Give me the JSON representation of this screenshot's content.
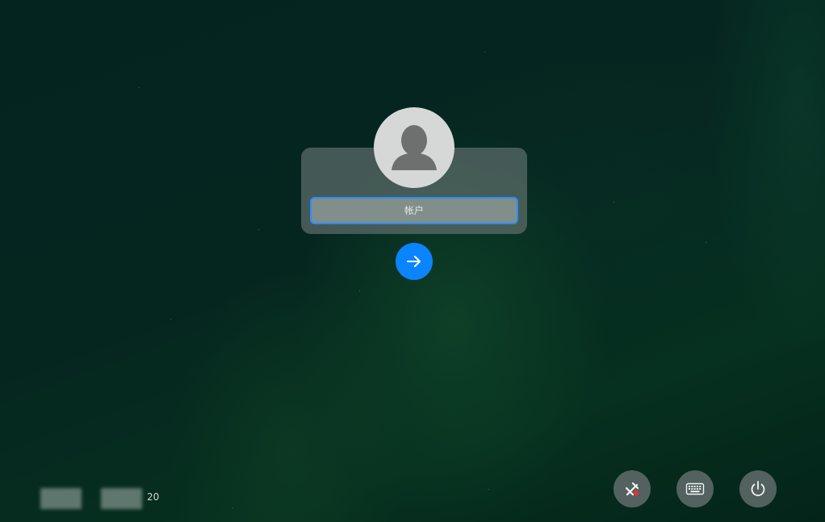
{
  "login": {
    "account_placeholder": "帐户",
    "account_value": ""
  },
  "clock": {
    "suffix_text": "20"
  },
  "icons": {
    "avatar": "user-silhouette-icon",
    "submit": "arrow-right-icon",
    "network": "network-disconnected-icon",
    "keyboard": "keyboard-icon",
    "power": "power-icon"
  },
  "colors": {
    "accent": "#0a84ff",
    "input_border": "#2b8bff",
    "network_error": "#e0323c"
  }
}
